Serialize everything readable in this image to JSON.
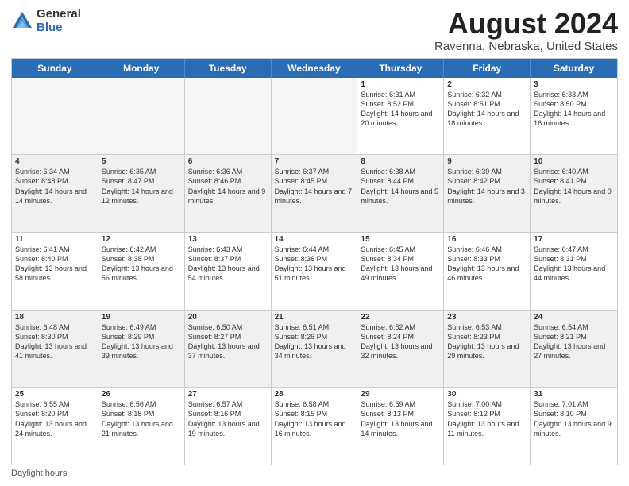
{
  "header": {
    "logo_general": "General",
    "logo_blue": "Blue",
    "month_title": "August 2024",
    "location": "Ravenna, Nebraska, United States"
  },
  "days_of_week": [
    "Sunday",
    "Monday",
    "Tuesday",
    "Wednesday",
    "Thursday",
    "Friday",
    "Saturday"
  ],
  "footer": {
    "daylight_label": "Daylight hours"
  },
  "weeks": [
    {
      "alt": false,
      "cells": [
        {
          "day": "",
          "text": ""
        },
        {
          "day": "",
          "text": ""
        },
        {
          "day": "",
          "text": ""
        },
        {
          "day": "",
          "text": ""
        },
        {
          "day": "1",
          "text": "Sunrise: 6:31 AM\nSunset: 8:52 PM\nDaylight: 14 hours and 20 minutes."
        },
        {
          "day": "2",
          "text": "Sunrise: 6:32 AM\nSunset: 8:51 PM\nDaylight: 14 hours and 18 minutes."
        },
        {
          "day": "3",
          "text": "Sunrise: 6:33 AM\nSunset: 8:50 PM\nDaylight: 14 hours and 16 minutes."
        }
      ]
    },
    {
      "alt": true,
      "cells": [
        {
          "day": "4",
          "text": "Sunrise: 6:34 AM\nSunset: 8:48 PM\nDaylight: 14 hours and 14 minutes."
        },
        {
          "day": "5",
          "text": "Sunrise: 6:35 AM\nSunset: 8:47 PM\nDaylight: 14 hours and 12 minutes."
        },
        {
          "day": "6",
          "text": "Sunrise: 6:36 AM\nSunset: 8:46 PM\nDaylight: 14 hours and 9 minutes."
        },
        {
          "day": "7",
          "text": "Sunrise: 6:37 AM\nSunset: 8:45 PM\nDaylight: 14 hours and 7 minutes."
        },
        {
          "day": "8",
          "text": "Sunrise: 6:38 AM\nSunset: 8:44 PM\nDaylight: 14 hours and 5 minutes."
        },
        {
          "day": "9",
          "text": "Sunrise: 6:39 AM\nSunset: 8:42 PM\nDaylight: 14 hours and 3 minutes."
        },
        {
          "day": "10",
          "text": "Sunrise: 6:40 AM\nSunset: 8:41 PM\nDaylight: 14 hours and 0 minutes."
        }
      ]
    },
    {
      "alt": false,
      "cells": [
        {
          "day": "11",
          "text": "Sunrise: 6:41 AM\nSunset: 8:40 PM\nDaylight: 13 hours and 58 minutes."
        },
        {
          "day": "12",
          "text": "Sunrise: 6:42 AM\nSunset: 8:38 PM\nDaylight: 13 hours and 56 minutes."
        },
        {
          "day": "13",
          "text": "Sunrise: 6:43 AM\nSunset: 8:37 PM\nDaylight: 13 hours and 54 minutes."
        },
        {
          "day": "14",
          "text": "Sunrise: 6:44 AM\nSunset: 8:36 PM\nDaylight: 13 hours and 51 minutes."
        },
        {
          "day": "15",
          "text": "Sunrise: 6:45 AM\nSunset: 8:34 PM\nDaylight: 13 hours and 49 minutes."
        },
        {
          "day": "16",
          "text": "Sunrise: 6:46 AM\nSunset: 8:33 PM\nDaylight: 13 hours and 46 minutes."
        },
        {
          "day": "17",
          "text": "Sunrise: 6:47 AM\nSunset: 8:31 PM\nDaylight: 13 hours and 44 minutes."
        }
      ]
    },
    {
      "alt": true,
      "cells": [
        {
          "day": "18",
          "text": "Sunrise: 6:48 AM\nSunset: 8:30 PM\nDaylight: 13 hours and 41 minutes."
        },
        {
          "day": "19",
          "text": "Sunrise: 6:49 AM\nSunset: 8:29 PM\nDaylight: 13 hours and 39 minutes."
        },
        {
          "day": "20",
          "text": "Sunrise: 6:50 AM\nSunset: 8:27 PM\nDaylight: 13 hours and 37 minutes."
        },
        {
          "day": "21",
          "text": "Sunrise: 6:51 AM\nSunset: 8:26 PM\nDaylight: 13 hours and 34 minutes."
        },
        {
          "day": "22",
          "text": "Sunrise: 6:52 AM\nSunset: 8:24 PM\nDaylight: 13 hours and 32 minutes."
        },
        {
          "day": "23",
          "text": "Sunrise: 6:53 AM\nSunset: 8:23 PM\nDaylight: 13 hours and 29 minutes."
        },
        {
          "day": "24",
          "text": "Sunrise: 6:54 AM\nSunset: 8:21 PM\nDaylight: 13 hours and 27 minutes."
        }
      ]
    },
    {
      "alt": false,
      "cells": [
        {
          "day": "25",
          "text": "Sunrise: 6:55 AM\nSunset: 8:20 PM\nDaylight: 13 hours and 24 minutes."
        },
        {
          "day": "26",
          "text": "Sunrise: 6:56 AM\nSunset: 8:18 PM\nDaylight: 13 hours and 21 minutes."
        },
        {
          "day": "27",
          "text": "Sunrise: 6:57 AM\nSunset: 8:16 PM\nDaylight: 13 hours and 19 minutes."
        },
        {
          "day": "28",
          "text": "Sunrise: 6:58 AM\nSunset: 8:15 PM\nDaylight: 13 hours and 16 minutes."
        },
        {
          "day": "29",
          "text": "Sunrise: 6:59 AM\nSunset: 8:13 PM\nDaylight: 13 hours and 14 minutes."
        },
        {
          "day": "30",
          "text": "Sunrise: 7:00 AM\nSunset: 8:12 PM\nDaylight: 13 hours and 11 minutes."
        },
        {
          "day": "31",
          "text": "Sunrise: 7:01 AM\nSunset: 8:10 PM\nDaylight: 13 hours and 9 minutes."
        }
      ]
    }
  ]
}
